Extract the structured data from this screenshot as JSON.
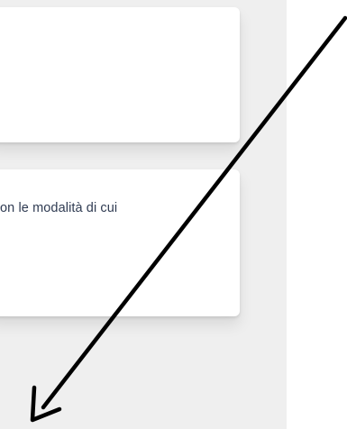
{
  "cards": [
    {
      "text": ""
    },
    {
      "text": "on le modalità di cui"
    }
  ],
  "annotation": {
    "icon": "arrow-icon",
    "color": "#000000"
  }
}
